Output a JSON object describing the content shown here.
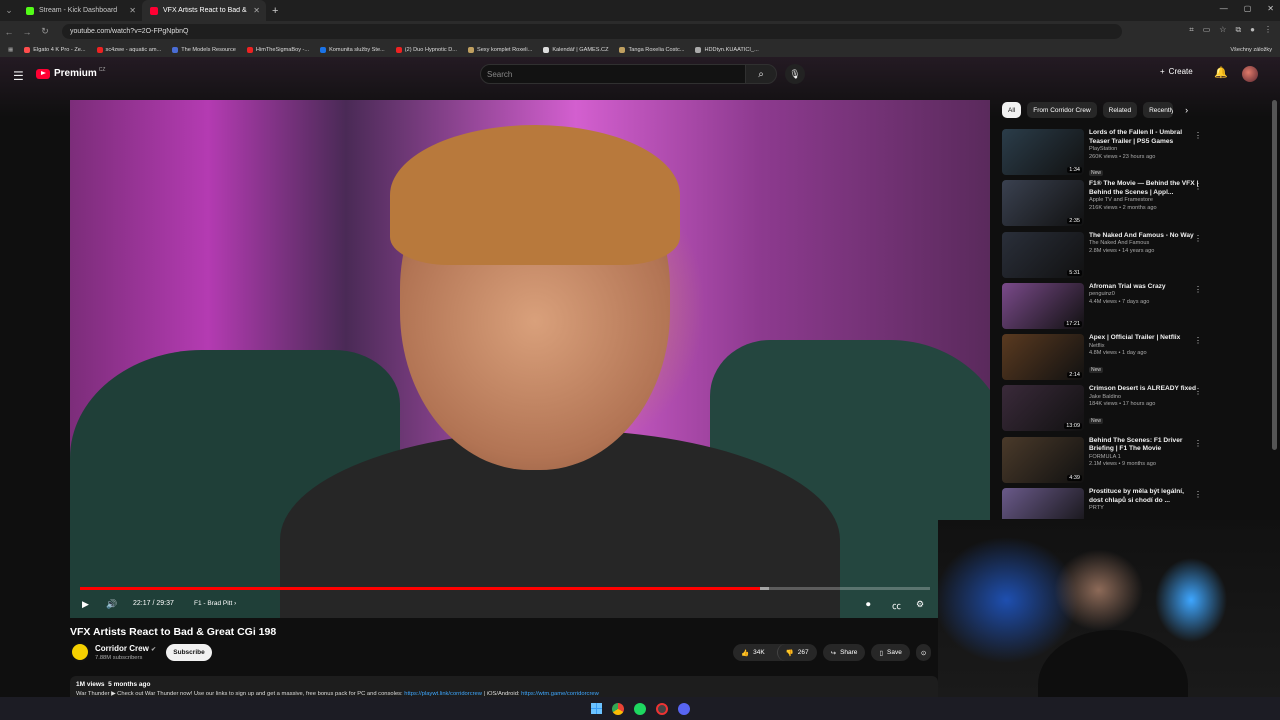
{
  "browser": {
    "tabs": [
      {
        "title": "Stream - Kick Dashboard",
        "color": "#53fc18",
        "active": false
      },
      {
        "title": "VFX Artists React to Bad & Great",
        "color": "#ff0033",
        "active": true
      }
    ],
    "new_tab": "+",
    "url": "youtube.com/watch?v=2O-FPgNpbnQ",
    "bookmarks": [
      {
        "label": "Elgato 4 K Pro - Ze...",
        "color": "#ff4d4d"
      },
      {
        "label": "sc4zwe - aquatic am...",
        "color": "#e22"
      },
      {
        "label": "The Models Resource",
        "color": "#4a6cd4"
      },
      {
        "label": "HimTheSigmaBoy -...",
        "color": "#e22"
      },
      {
        "label": "Komunita služby Ste...",
        "color": "#1b73e8"
      },
      {
        "label": "(2) Duo Hypnotic D...",
        "color": "#e22"
      },
      {
        "label": "Sexy komplet Roxeli...",
        "color": "#c0a060"
      },
      {
        "label": "Kalendář | GAMES.CZ",
        "color": "#ddd"
      },
      {
        "label": "Tanga Roxelia Costc...",
        "color": "#c0a060"
      },
      {
        "label": "HDDtyn.KUAATICI_...",
        "color": "#aaa"
      }
    ],
    "bookmarks_right": "Všechny záložky"
  },
  "header": {
    "logo": "Premium",
    "logo_sup": "CZ",
    "search_placeholder": "Search",
    "create": "Create"
  },
  "player": {
    "time": "22:17 / 29:37",
    "chapter": "F1 - Brad Pitt",
    "progress": 0.8,
    "buffered": 0.81
  },
  "video": {
    "title": "VFX Artists React to Bad & Great CGi 198",
    "channel": "Corridor Crew",
    "subscribers": "7.88M subscribers",
    "subscribe": "Subscribe",
    "likes": "34K",
    "dislikes": "267",
    "share": "Share",
    "save": "Save",
    "views": "1M views",
    "age": "5 months ago",
    "description": "War Thunder ▶ Check out War Thunder now! Use our links to sign up and get a massive, free bonus pack for PC and consoles:",
    "link1": "https://playwt.link/corridorcrew",
    "mid": " | iOS/Android:",
    "link2": "https://wtm.game/corridorcrew"
  },
  "chips": [
    "All",
    "From Corridor Crew",
    "Related",
    "Recently"
  ],
  "recommendations": [
    {
      "title": "Lords of the Fallen II - Umbral Teaser Trailer | PS5 Games",
      "channel": "PlayStation",
      "meta": "260K views • 23 hours ago",
      "duration": "1:34",
      "badge": "New",
      "color": "#2b3d4a"
    },
    {
      "title": "F1® The Movie — Behind the VFX | Behind the Scenes | Appl...",
      "channel": "Apple TV and Framestore",
      "meta": "216K views • 2 months ago",
      "duration": "2:35",
      "badge": "",
      "color": "#3a4150"
    },
    {
      "title": "The Naked And Famous - No Way",
      "channel": "The Naked And Famous",
      "meta": "2.8M views • 14 years ago",
      "duration": "5:31",
      "badge": "",
      "color": "#2a2f3a"
    },
    {
      "title": "Afroman Trial was Crazy",
      "channel": "penguinz0",
      "meta": "4.4M views • 7 days ago",
      "duration": "17:21",
      "badge": "",
      "color": "#7a4a8a"
    },
    {
      "title": "Apex | Official Trailer | Netflix",
      "channel": "Netflix",
      "meta": "4.8M views • 1 day ago",
      "duration": "2:14",
      "badge": "New",
      "color": "#5a3a20"
    },
    {
      "title": "Crimson Desert is ALREADY fixed",
      "channel": "Jake Baldino",
      "meta": "184K views • 17 hours ago",
      "duration": "13:09",
      "badge": "New",
      "color": "#3a2a3a"
    },
    {
      "title": "Behind The Scenes: F1 Driver Briefing | F1 The Movie",
      "channel": "FORMULA 1",
      "meta": "2.1M views • 9 months ago",
      "duration": "4:39",
      "badge": "",
      "color": "#4a3a2a"
    },
    {
      "title": "Prostituce by měla být legální, dost chlapů si chodí do ...",
      "channel": "PRTY",
      "meta": "",
      "duration": "",
      "badge": "",
      "color": "#6a5a8a"
    }
  ]
}
